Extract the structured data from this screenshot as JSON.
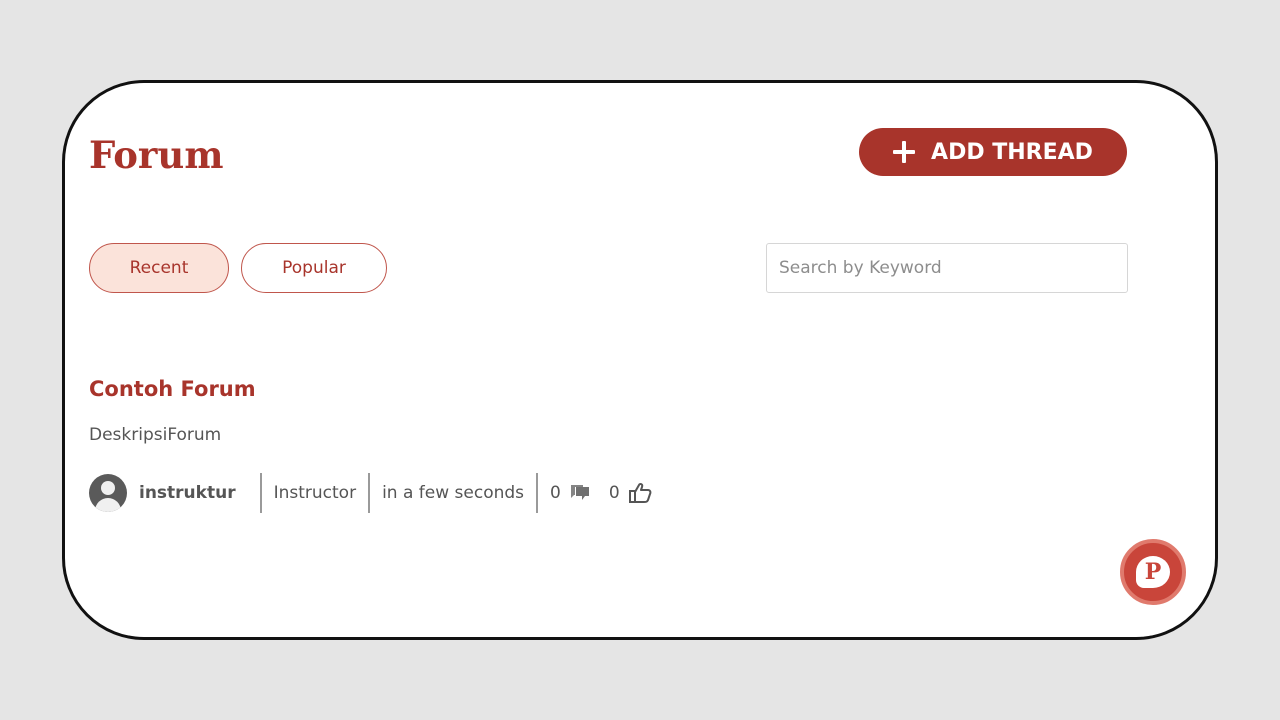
{
  "page": {
    "title": "Forum",
    "add_thread_label": "ADD THREAD",
    "tabs": [
      {
        "label": "Recent",
        "active": true
      },
      {
        "label": "Popular",
        "active": false
      }
    ],
    "search": {
      "placeholder": "Search by Keyword",
      "value": ""
    }
  },
  "thread": {
    "title": "Contoh Forum",
    "description": "DeskripsiForum",
    "author": "instruktur",
    "role": "Instructor",
    "time": "in a few seconds",
    "comment_count": "0",
    "like_count": "0"
  },
  "chat_fab": {
    "letter": "P"
  },
  "colors": {
    "accent": "#a8342b",
    "tab_active_bg": "#fbe3da",
    "background": "#e5e5e5",
    "fab": "#c9453a"
  },
  "icons": {
    "add": "plus-icon",
    "avatar": "user-avatar-icon",
    "comments": "comment-icon",
    "likes": "thumbs-up-icon",
    "chat": "chat-bubble-icon"
  }
}
